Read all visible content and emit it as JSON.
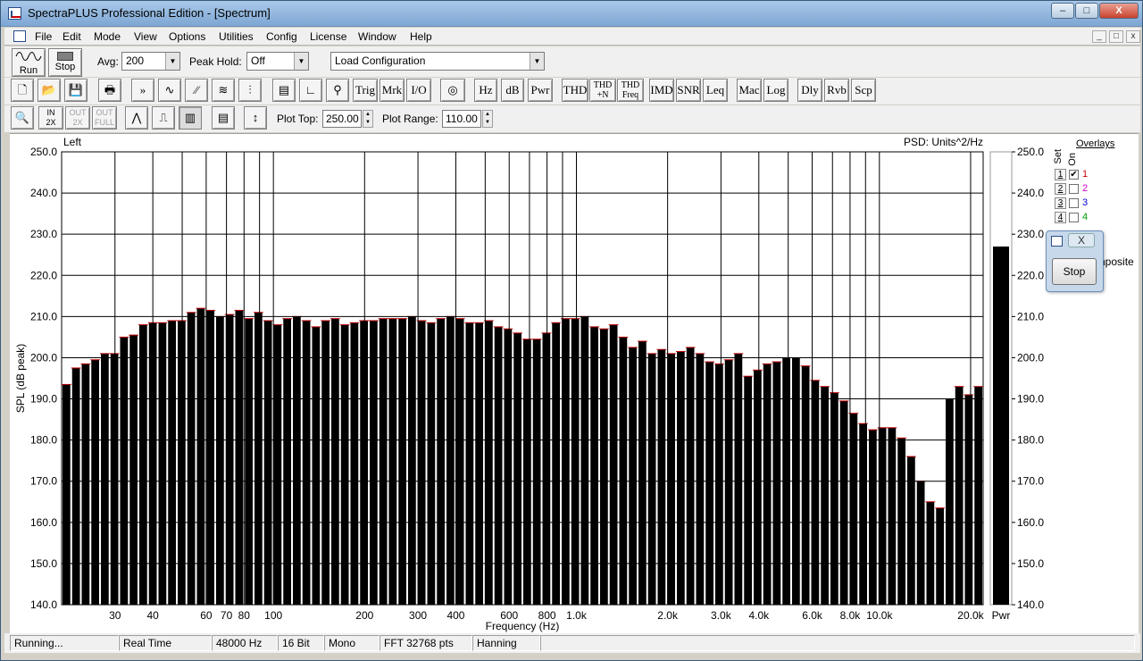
{
  "window": {
    "title": "SpectraPLUS Professional Edition - [Spectrum]",
    "buttons": {
      "minimize": "–",
      "restore": "□",
      "close": "X"
    }
  },
  "menu": [
    "File",
    "Edit",
    "Mode",
    "View",
    "Options",
    "Utilities",
    "Config",
    "License",
    "Window",
    "Help"
  ],
  "mdi_buttons": {
    "minimize": "_",
    "restore": "□",
    "close": "x"
  },
  "toolbar1": {
    "run_label": "Run",
    "stop_label": "Stop",
    "avg_label": "Avg:",
    "avg_value": "200",
    "peakhold_label": "Peak Hold:",
    "peakhold_value": "Off",
    "config_value": "Load Configuration"
  },
  "toolbar2": {
    "text_buttons": [
      "Trig",
      "Mrk",
      "I/O",
      "Hz",
      "dB",
      "Pwr",
      "THD",
      "THD\n+N",
      "THD\nFreq",
      "IMD",
      "SNR",
      "Leq",
      "Mac",
      "Log",
      "Dly",
      "Rvb",
      "Scp"
    ]
  },
  "toolbar3": {
    "zoom_in_label": "IN\n2X",
    "zoom_out_label": "OUT\n2X",
    "zoom_full_label": "OUT\nFULL",
    "plot_top_label": "Plot Top:",
    "plot_top_value": "250.00",
    "plot_range_label": "Plot Range:",
    "plot_range_value": "110.00"
  },
  "plot": {
    "channel_label": "Left",
    "units_label": "PSD: Units^2/Hz",
    "ylabel": "SPL (dB peak)",
    "xlabel": "Frequency (Hz)",
    "pwr_label": "Pwr"
  },
  "chart_data": {
    "type": "bar",
    "x_scale": "log",
    "xlim": [
      20,
      22000
    ],
    "ylim": [
      140,
      250
    ],
    "y_ticks": [
      "250.0",
      "240.0",
      "230.0",
      "220.0",
      "210.0",
      "200.0",
      "190.0",
      "180.0",
      "170.0",
      "160.0",
      "150.0",
      "140.0"
    ],
    "x_ticks": [
      {
        "v": 30,
        "label": "30"
      },
      {
        "v": 40,
        "label": "40"
      },
      {
        "v": 60,
        "label": "60"
      },
      {
        "v": 70,
        "label": "70"
      },
      {
        "v": 80,
        "label": "80"
      },
      {
        "v": 100,
        "label": "100"
      },
      {
        "v": 200,
        "label": "200"
      },
      {
        "v": 300,
        "label": "300"
      },
      {
        "v": 400,
        "label": "400"
      },
      {
        "v": 600,
        "label": "600"
      },
      {
        "v": 800,
        "label": "800"
      },
      {
        "v": 1000,
        "label": "1.0k"
      },
      {
        "v": 2000,
        "label": "2.0k"
      },
      {
        "v": 3000,
        "label": "3.0k"
      },
      {
        "v": 4000,
        "label": "4.0k"
      },
      {
        "v": 6000,
        "label": "6.0k"
      },
      {
        "v": 8000,
        "label": "8.0k"
      },
      {
        "v": 10000,
        "label": "10.0k"
      },
      {
        "v": 20000,
        "label": "20.0k"
      }
    ],
    "grid_lines": [
      30,
      40,
      50,
      60,
      70,
      80,
      90,
      100,
      200,
      300,
      400,
      500,
      600,
      700,
      800,
      900,
      1000,
      2000,
      3000,
      4000,
      5000,
      6000,
      7000,
      8000,
      9000,
      10000,
      20000
    ],
    "bar_count": 96,
    "values": [
      193.5,
      197.5,
      198.5,
      199.5,
      201,
      201,
      205,
      205.5,
      208,
      208.5,
      208.5,
      209,
      209,
      211,
      212,
      211.5,
      210,
      210.5,
      211.5,
      209.5,
      211,
      209,
      208,
      209.5,
      210,
      209,
      207.5,
      209,
      209.5,
      208,
      208.5,
      209,
      209,
      209.5,
      209.5,
      209.5,
      210,
      209,
      208.5,
      209.5,
      210,
      209.5,
      208.5,
      208.5,
      209,
      207.5,
      207,
      206,
      204.5,
      204.5,
      206,
      208.5,
      209.5,
      209.5,
      210,
      207.5,
      207,
      208,
      205,
      202.5,
      204,
      201,
      202,
      201,
      201.5,
      202.5,
      201,
      199,
      198.5,
      199.5,
      201,
      195.5,
      197,
      198.5,
      199,
      200,
      200,
      198,
      194.5,
      193,
      191.5,
      189.5,
      186.5,
      184,
      182.5,
      183,
      183,
      180.5,
      176,
      170,
      165,
      163.5,
      190,
      193,
      191,
      193
    ],
    "level_meter": {
      "value": 227,
      "range": [
        140,
        250
      ],
      "ticks": [
        "250.0",
        "240.0",
        "230.0",
        "220.0",
        "210.0",
        "200.0",
        "190.0",
        "180.0",
        "170.0",
        "160.0",
        "150.0",
        "140.0"
      ]
    }
  },
  "overlays": {
    "title": "Overlays",
    "set_header": "Set",
    "on_header": "On",
    "composite_label": "nposite",
    "rows": [
      {
        "set": "1",
        "checked": true,
        "num": "1",
        "color": "#cc0000"
      },
      {
        "set": "2",
        "checked": false,
        "num": "2",
        "color": "#cc00cc"
      },
      {
        "set": "3",
        "checked": false,
        "num": "3",
        "color": "#0000cc"
      },
      {
        "set": "4",
        "checked": false,
        "num": "4",
        "color": "#009900"
      }
    ]
  },
  "stop_dialog": {
    "close_label": "X",
    "stop_label": "Stop"
  },
  "status": [
    "Running...",
    "Real Time",
    "48000 Hz",
    "16 Bit",
    "Mono",
    "FFT 32768 pts",
    "Hanning"
  ]
}
